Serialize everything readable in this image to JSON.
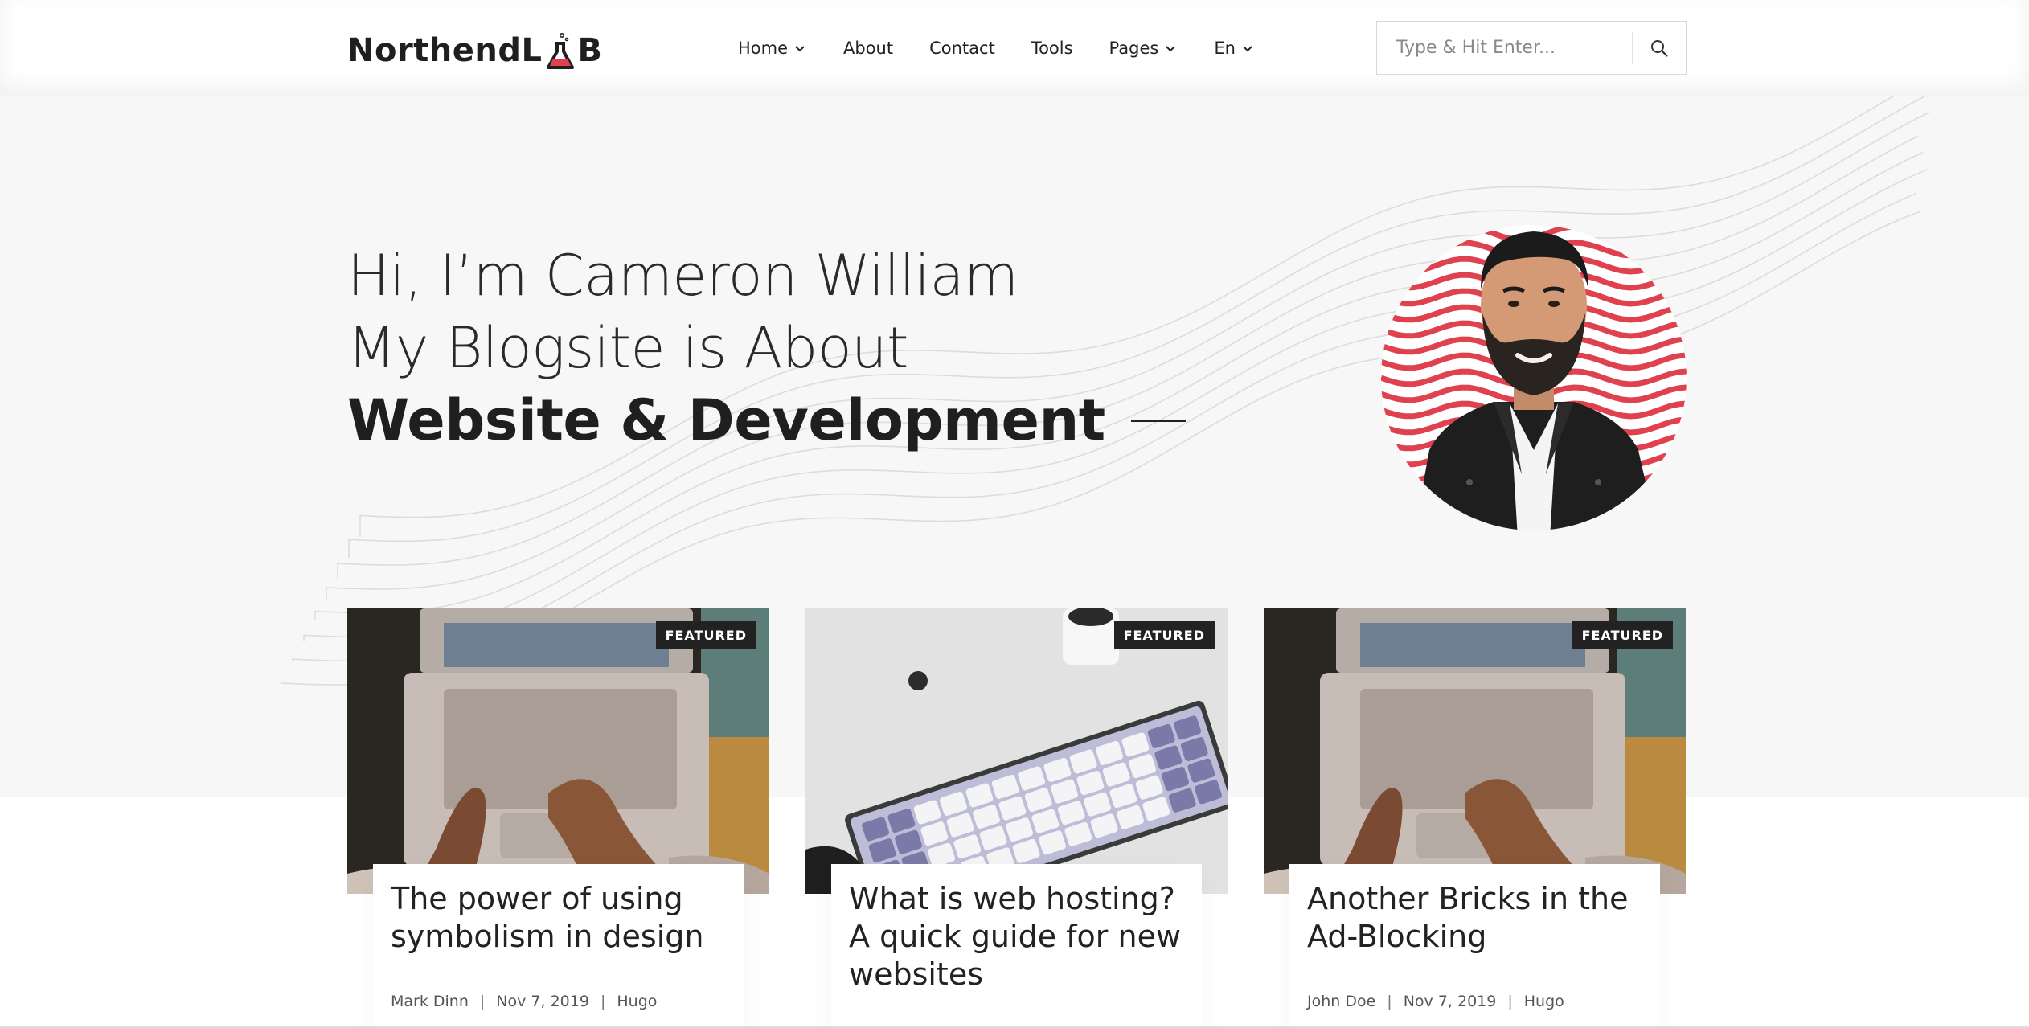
{
  "brand": {
    "name_left": "Northend",
    "name_right": "B",
    "accent": "#e0414f"
  },
  "nav": {
    "items": [
      {
        "label": "Home",
        "has_dropdown": true
      },
      {
        "label": "About",
        "has_dropdown": false
      },
      {
        "label": "Contact",
        "has_dropdown": false
      },
      {
        "label": "Tools",
        "has_dropdown": false
      },
      {
        "label": "Pages",
        "has_dropdown": true
      },
      {
        "label": "En",
        "has_dropdown": true
      }
    ]
  },
  "search": {
    "placeholder": "Type & Hit Enter...",
    "icon": "search-icon"
  },
  "hero": {
    "line1": "Hi, I’m Cameron William",
    "line2": "My Blogsite is About",
    "line3": "Website & Development"
  },
  "cards": [
    {
      "badge": "FEATURED",
      "title": "The power of using symbolism in design",
      "author": "Mark Dinn",
      "date": "Nov 7, 2019",
      "category": "Hugo",
      "image": "laptop-hands"
    },
    {
      "badge": "FEATURED",
      "title": "What is web hosting? A quick guide for new websites",
      "author": "",
      "date": "",
      "category": "",
      "image": "keyboard-desk"
    },
    {
      "badge": "FEATURED",
      "title": "Another Bricks in the Ad-Blocking",
      "author": "John Doe",
      "date": "Nov 7, 2019",
      "category": "Hugo",
      "image": "laptop-hands"
    }
  ],
  "meta_separator": "|"
}
